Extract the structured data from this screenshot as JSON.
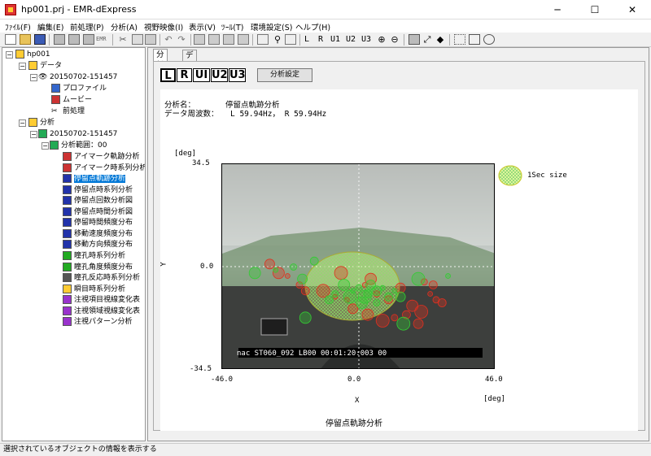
{
  "window": {
    "title": "hp001.prj - EMR-dExpress",
    "minimize": "─",
    "maximize": "☐",
    "close": "✕"
  },
  "menu": [
    "ﾌｧｲﾙ(F)",
    "編集(E)",
    "前処理(P)",
    "分析(A)",
    "視野映像(I)",
    "表示(V)",
    "ﾂｰﾙ(T)",
    "環境設定(S)",
    "ヘルプ(H)"
  ],
  "toolbar": {
    "eye_labels": [
      "L",
      "R",
      "U1",
      "U2",
      "U3"
    ],
    "emr_label": "EMR"
  },
  "tree": {
    "root": "hp001",
    "data_label": "データ",
    "data_session": "20150702-151457",
    "profile": "プロファイル",
    "movie": "ムービー",
    "preprocess": "前処理",
    "analysis_label": "分析",
    "analysis_session": "20150702-151457",
    "range": "分析範囲：00",
    "items": [
      "アイマーク軌跡分析",
      "アイマーク時系列分析",
      "停留点軌跡分析",
      "停留点時系列分析",
      "停留点回数分析図",
      "停留点時間分析図",
      "停留時間頻度分布",
      "移動速度頻度分布",
      "移動方向頻度分布",
      "瞳孔時系列分析",
      "瞳孔角度頻度分布",
      "瞳孔反応時系列分析",
      "瞬目時系列分析",
      "注視項目視線変化表",
      "注視領域視線変化表",
      "注視パターン分析"
    ],
    "selected_index": 2
  },
  "tabs": [
    "分析図",
    "データ"
  ],
  "eye_buttons": [
    "L",
    "R",
    "UI",
    "U2",
    "U3"
  ],
  "settings_button": "分析設定",
  "info": {
    "name_label": "分析名：",
    "name_value": "停留点軌跡分析",
    "freq_label": "データ周波数：",
    "freq_value": "L 59.94Hz， R 59.94Hz"
  },
  "chart_data": {
    "type": "scatter",
    "title": "停留点軌跡分析",
    "xlabel": "X",
    "ylabel": "Y",
    "x_unit": "[deg]",
    "y_unit": "[deg]",
    "xlim": [
      -46.0,
      46.0
    ],
    "ylim": [
      -34.5,
      34.5
    ],
    "x_ticks": [
      "-46.0",
      "0.0",
      "46.0"
    ],
    "y_ticks": [
      "34.5",
      "0.0",
      "-34.5"
    ],
    "legend": "1Sec size",
    "video_overlay": "nac ST060_092 LB00 00:01:20:003   00",
    "series": [
      {
        "name": "L",
        "color": "#e03020",
        "points": [
          [
            -24,
            -3
          ],
          [
            -20,
            -6
          ],
          [
            -18,
            -8
          ],
          [
            -30,
            1
          ],
          [
            -27,
            -2
          ],
          [
            -12,
            -8
          ],
          [
            -8,
            -10
          ],
          [
            6,
            -9
          ],
          [
            10,
            -11
          ],
          [
            14,
            -7
          ],
          [
            18,
            -13
          ],
          [
            21,
            -15
          ],
          [
            24,
            -9
          ],
          [
            26,
            -11
          ],
          [
            28,
            -12
          ],
          [
            -2,
            -14
          ],
          [
            3,
            -16
          ],
          [
            8,
            -18
          ],
          [
            -4,
            -11
          ],
          [
            12,
            -17
          ],
          [
            16,
            -16
          ],
          [
            20,
            -19
          ],
          [
            4,
            -4
          ],
          [
            -6,
            -2
          ],
          [
            2,
            -6
          ],
          [
            22,
            -5
          ],
          [
            25,
            -6
          ]
        ]
      },
      {
        "name": "R",
        "color": "#33cc33",
        "points": [
          [
            -2,
            -8
          ],
          [
            0,
            -7
          ],
          [
            3,
            -9
          ],
          [
            6,
            -8
          ],
          [
            -5,
            -6
          ],
          [
            2,
            -10
          ],
          [
            8,
            -7
          ],
          [
            -8,
            -9
          ],
          [
            10,
            -10
          ],
          [
            4,
            -6
          ],
          [
            1,
            -12
          ],
          [
            -3,
            -10
          ],
          [
            12,
            -8
          ],
          [
            6,
            -12
          ],
          [
            -10,
            -11
          ],
          [
            14,
            -10
          ],
          [
            -18,
            -17
          ],
          [
            15,
            -19
          ],
          [
            -28,
            -1
          ],
          [
            -22,
            0
          ],
          [
            -15,
            2
          ],
          [
            -19,
            -4
          ],
          [
            -35,
            -2
          ],
          [
            20,
            -4
          ],
          [
            30,
            -3
          ]
        ]
      }
    ]
  }
}
